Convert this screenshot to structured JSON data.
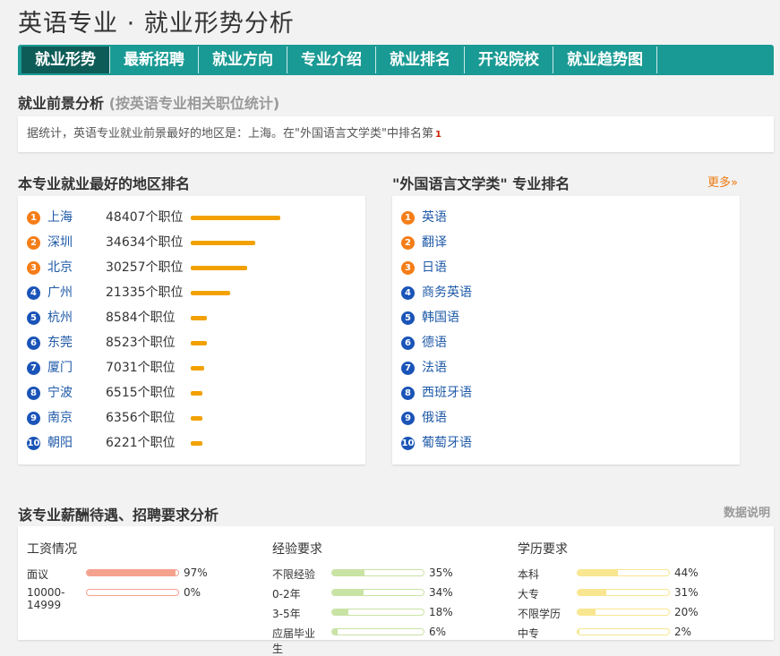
{
  "page": {
    "title": "英语专业 · 就业形势分析"
  },
  "tabs": [
    "就业形势",
    "最新招聘",
    "就业方向",
    "专业介绍",
    "就业排名",
    "开设院校",
    "就业趋势图"
  ],
  "prospect": {
    "title": "就业前景分析",
    "subtitle": "(按英语专业相关职位统计)",
    "summary_text": "据统计，英语专业就业前景最好的地区是：上海。在\"外国语言文学类\"中排名第",
    "summary_rank": "1"
  },
  "regions": {
    "title": "本专业就业最好的地区排名",
    "max": 48407,
    "items": [
      {
        "rank": "1",
        "name": "上海",
        "jobs": "48407个职位",
        "count": 48407
      },
      {
        "rank": "2",
        "name": "深圳",
        "jobs": "34634个职位",
        "count": 34634
      },
      {
        "rank": "3",
        "name": "北京",
        "jobs": "30257个职位",
        "count": 30257
      },
      {
        "rank": "4",
        "name": "广州",
        "jobs": "21335个职位",
        "count": 21335
      },
      {
        "rank": "5",
        "name": "杭州",
        "jobs": "8584个职位",
        "count": 8584
      },
      {
        "rank": "6",
        "name": "东莞",
        "jobs": "8523个职位",
        "count": 8523
      },
      {
        "rank": "7",
        "name": "厦门",
        "jobs": "7031个职位",
        "count": 7031
      },
      {
        "rank": "8",
        "name": "宁波",
        "jobs": "6515个职位",
        "count": 6515
      },
      {
        "rank": "9",
        "name": "南京",
        "jobs": "6356个职位",
        "count": 6356
      },
      {
        "rank": "10",
        "name": "朝阳",
        "jobs": "6221个职位",
        "count": 6221
      }
    ]
  },
  "majors": {
    "title": "\"外国语言文学类\" 专业排名",
    "more": "更多»",
    "items": [
      {
        "rank": "1",
        "name": "英语"
      },
      {
        "rank": "2",
        "name": "翻译"
      },
      {
        "rank": "3",
        "name": "日语"
      },
      {
        "rank": "4",
        "name": "商务英语"
      },
      {
        "rank": "5",
        "name": "韩国语"
      },
      {
        "rank": "6",
        "name": "德语"
      },
      {
        "rank": "7",
        "name": "法语"
      },
      {
        "rank": "8",
        "name": "西班牙语"
      },
      {
        "rank": "9",
        "name": "俄语"
      },
      {
        "rank": "10",
        "name": "葡萄牙语"
      }
    ]
  },
  "salary": {
    "title": "该专业薪酬待遇、招聘要求分析",
    "note": "数据说明",
    "columns": [
      {
        "heading": "工资情况",
        "color": "#f4a18e",
        "rows": [
          {
            "label": "面议",
            "pct": "97%",
            "value": 97
          },
          {
            "label": "10000-14999",
            "pct": "0%",
            "value": 0
          }
        ]
      },
      {
        "heading": "经验要求",
        "color": "#c8e3a4",
        "rows": [
          {
            "label": "不限经验",
            "pct": "35%",
            "value": 35
          },
          {
            "label": "0-2年",
            "pct": "34%",
            "value": 34
          },
          {
            "label": "3-5年",
            "pct": "18%",
            "value": 18
          },
          {
            "label": "应届毕业生",
            "pct": "6%",
            "value": 6
          }
        ]
      },
      {
        "heading": "学历要求",
        "color": "#f8e690",
        "rows": [
          {
            "label": "本科",
            "pct": "44%",
            "value": 44
          },
          {
            "label": "大专",
            "pct": "31%",
            "value": 31
          },
          {
            "label": "不限学历",
            "pct": "20%",
            "value": 20
          },
          {
            "label": "中专",
            "pct": "2%",
            "value": 2
          }
        ]
      }
    ]
  }
}
